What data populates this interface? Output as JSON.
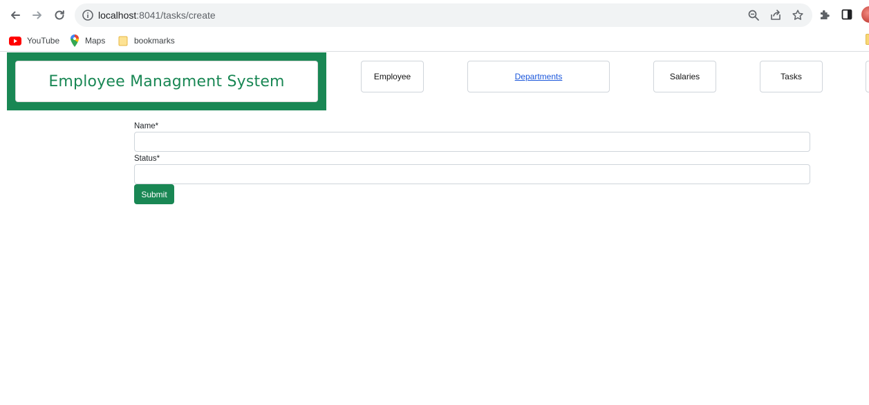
{
  "browser": {
    "url_host": "localhost",
    "url_path": ":8041/tasks/create",
    "bookmarks": [
      {
        "label": "YouTube"
      },
      {
        "label": "Maps"
      },
      {
        "label": "bookmarks"
      }
    ]
  },
  "header": {
    "brand_title": "Employee Managment System",
    "nav": [
      {
        "label": "Employee"
      },
      {
        "label": "Departments"
      },
      {
        "label": "Salaries"
      },
      {
        "label": "Tasks"
      }
    ]
  },
  "form": {
    "name_label": "Name*",
    "name_value": "",
    "status_label": "Status*",
    "status_value": "",
    "submit_label": "Submit"
  },
  "colors": {
    "brand_green": "#198754",
    "link_blue": "#1a56db"
  }
}
